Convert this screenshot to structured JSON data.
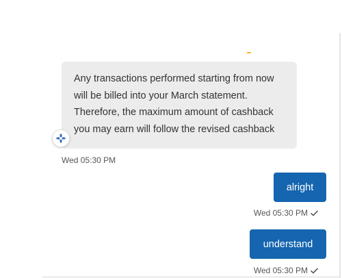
{
  "bot_message": {
    "lines": [
      "Any transactions performed starting from now",
      "will be billed into your March statement.",
      "Therefore, the maximum amount of cashback",
      "you may earn will follow the revised cashback"
    ],
    "timestamp": "Wed 05:30 PM",
    "avatar_icon": "bot-avatar-icon"
  },
  "user_messages": [
    {
      "text": "alright",
      "timestamp": "Wed 05:30 PM",
      "status_icon": "check-icon"
    },
    {
      "text": "understand",
      "timestamp": "Wed 05:30 PM",
      "status_icon": "check-icon"
    }
  ],
  "colors": {
    "user_bubble": "#1565b0",
    "bot_bubble": "#ececec",
    "accent": "#f5b324",
    "avatar_icon": "#3a6fb6"
  }
}
